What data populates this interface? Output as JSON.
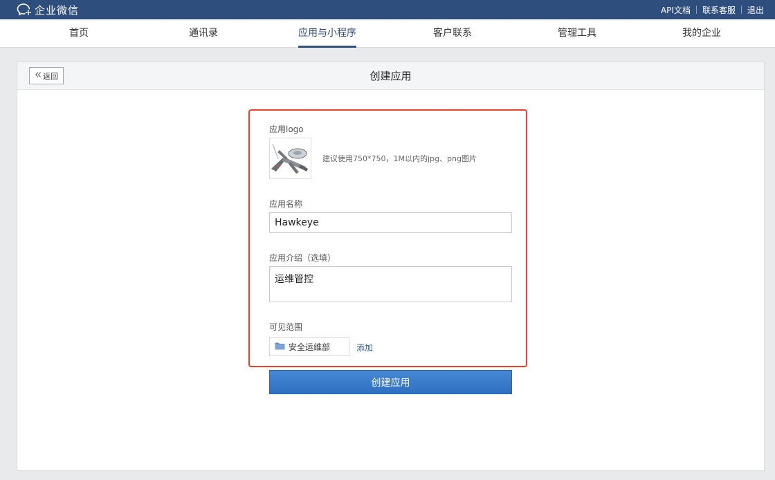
{
  "topbar": {
    "brand": "企业微信",
    "links": [
      "API文档",
      "联系客服",
      "退出"
    ]
  },
  "nav": {
    "items": [
      "首页",
      "通讯录",
      "应用与小程序",
      "客户联系",
      "管理工具",
      "我的企业"
    ],
    "active": "应用与小程序"
  },
  "page": {
    "back_label": "返回",
    "title": "创建应用"
  },
  "form": {
    "logo_label": "应用logo",
    "logo_hint": "建议使用750*750，1M以内的jpg、png图片",
    "name_label": "应用名称",
    "name_value": "Hawkeye",
    "desc_label": "应用介绍（选填）",
    "desc_value": "运维管控",
    "visibility_label": "可见范围",
    "department": "安全运维部",
    "add_label": "添加",
    "submit_label": "创建应用"
  },
  "colors": {
    "topbar": "#2e4e7e",
    "highlight": "#e8432a",
    "primary_button": "#3a7bd0",
    "link": "#2e5c98"
  }
}
